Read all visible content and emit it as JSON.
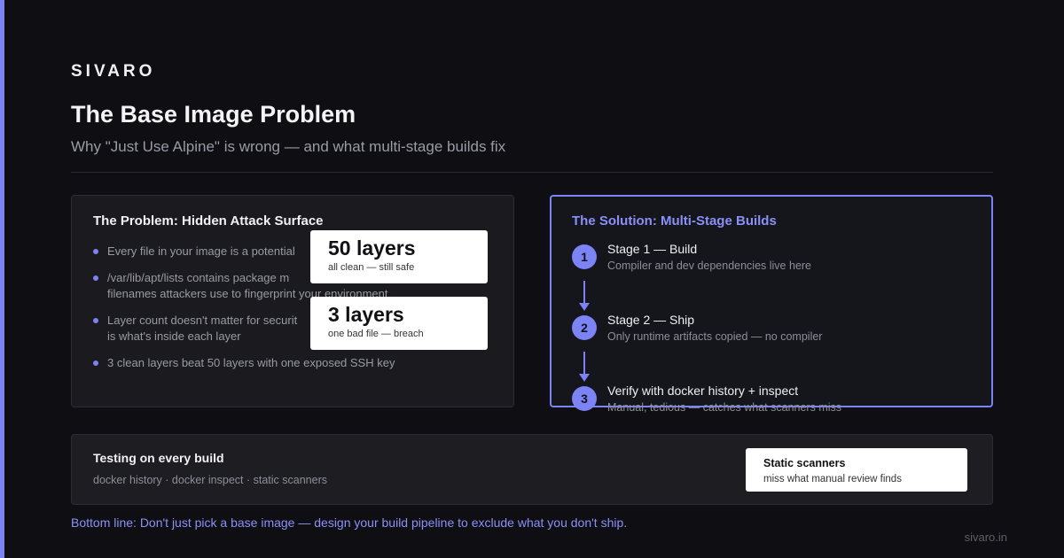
{
  "brand": "SIVARO",
  "title": "The Base Image Problem",
  "subtitle": "Why \"Just Use Alpine\" is wrong — and what multi-stage builds fix",
  "problem": {
    "title": "The Problem: Hidden Attack Surface",
    "bullets": [
      "Every file in your image is a potential",
      "/var/lib/apt/lists contains package m\nfilenames attackers use to fingerprint your environment",
      "Layer count doesn't matter for securit\nis what's inside each layer",
      "3 clean layers beat 50 layers with one exposed SSH key"
    ],
    "stats": [
      {
        "big": "50 layers",
        "small": "all clean — still safe"
      },
      {
        "big": "3 layers",
        "small": "one bad file — breach"
      }
    ]
  },
  "solution": {
    "title": "The Solution: Multi-Stage Builds",
    "steps": [
      {
        "num": "1",
        "name": "Stage 1 — Build",
        "desc": "Compiler and dev dependencies live here"
      },
      {
        "num": "2",
        "name": "Stage 2 — Ship",
        "desc": "Only runtime artifacts copied — no compiler"
      },
      {
        "num": "3",
        "name": "Verify with docker history + inspect",
        "desc": "Manual, tedious — catches what scanners miss"
      }
    ]
  },
  "testing": {
    "title": "Testing on every build",
    "tools": "docker history · docker inspect · static scanners",
    "note_title": "Static scanners",
    "note_desc": "miss what manual review finds"
  },
  "bottom_line": "Bottom line: Don't just pick a base image — design your build pipeline to exclude what you don't ship.",
  "footer": "sivaro.in",
  "colors": {
    "accent": "#7c83f5",
    "background": "#0f0f13",
    "card": "#1a1a1f"
  }
}
